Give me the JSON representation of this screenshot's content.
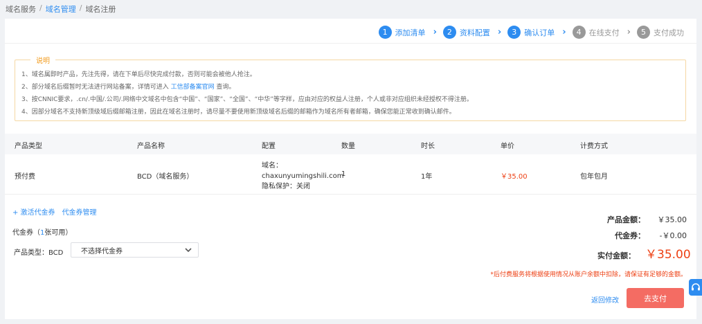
{
  "breadcrumb": {
    "items": [
      "域名服务",
      "域名管理",
      "域名注册"
    ],
    "separator": "/"
  },
  "steps": [
    {
      "num": "1",
      "label": "添加清单",
      "active": true
    },
    {
      "num": "2",
      "label": "资料配置",
      "active": true
    },
    {
      "num": "3",
      "label": "确认订单",
      "active": true
    },
    {
      "num": "4",
      "label": "在线支付",
      "active": false
    },
    {
      "num": "5",
      "label": "支付成功",
      "active": false
    }
  ],
  "notice": {
    "title": "说明",
    "items": [
      "1、域名属即时产品，先注先得，请在下单后尽快完成付款，否则可能会被他人抢注。",
      "2、部分域名后缀暂时无法进行网站备案，详情可进入",
      "3、按CNNIC要求，.cn/.中国/.公司/.网络中文域名中包含“中国”、“国家”、“全国”、“中华”等字样，应由对应的权益人注册，个人或非对应组织未经授权不得注册。",
      "4、因部分域名不支持新顶级域后缀邮箱注册，因此在域名注册时，请尽量不要使用新顶级域名后缀的邮箱作为域名所有者邮箱，确保您能正常收到确认邮件。"
    ],
    "link_text": "工信部备案官网",
    "link_suffix": "查询。"
  },
  "table": {
    "headers": [
      "产品类型",
      "产品名称",
      "配置",
      "数量",
      "时长",
      "单价",
      "计费方式"
    ],
    "row": {
      "type": "预付费",
      "name": "BCD（域名服务）",
      "config_line1": "域名：",
      "config_line2": "chaxunyumingshili.com",
      "config_line3": "隐私保护：关闭",
      "quantity": "1",
      "duration": "1年",
      "price": "￥35.00",
      "billing": "包年包月"
    }
  },
  "voucher": {
    "activate_link": "+ 激活代金券",
    "manage_link": "代金券管理",
    "count_prefix": "代金券（",
    "count_value": "1",
    "count_suffix": "张可用）",
    "type_label": "产品类型：BCD",
    "select_value": "不选择代金券"
  },
  "summary": {
    "product_amount_label": "产品金额：",
    "product_amount": "￥35.00",
    "voucher_label": "代金券：",
    "voucher_amount": "-￥0.00",
    "paid_label": "实付金额：",
    "paid_amount": "￥35.00",
    "note": "*后付费服务将根据使用情况从账户余额中扣除，请保证有足够的金额。"
  },
  "actions": {
    "back_label": "返回修改",
    "pay_label": "去支付"
  },
  "colors": {
    "primary": "#2d8cf0",
    "danger": "#ed4014",
    "pay_button": "#f46c63",
    "notice_border": "#f5d7a3",
    "notice_title": "#f29b1d"
  }
}
